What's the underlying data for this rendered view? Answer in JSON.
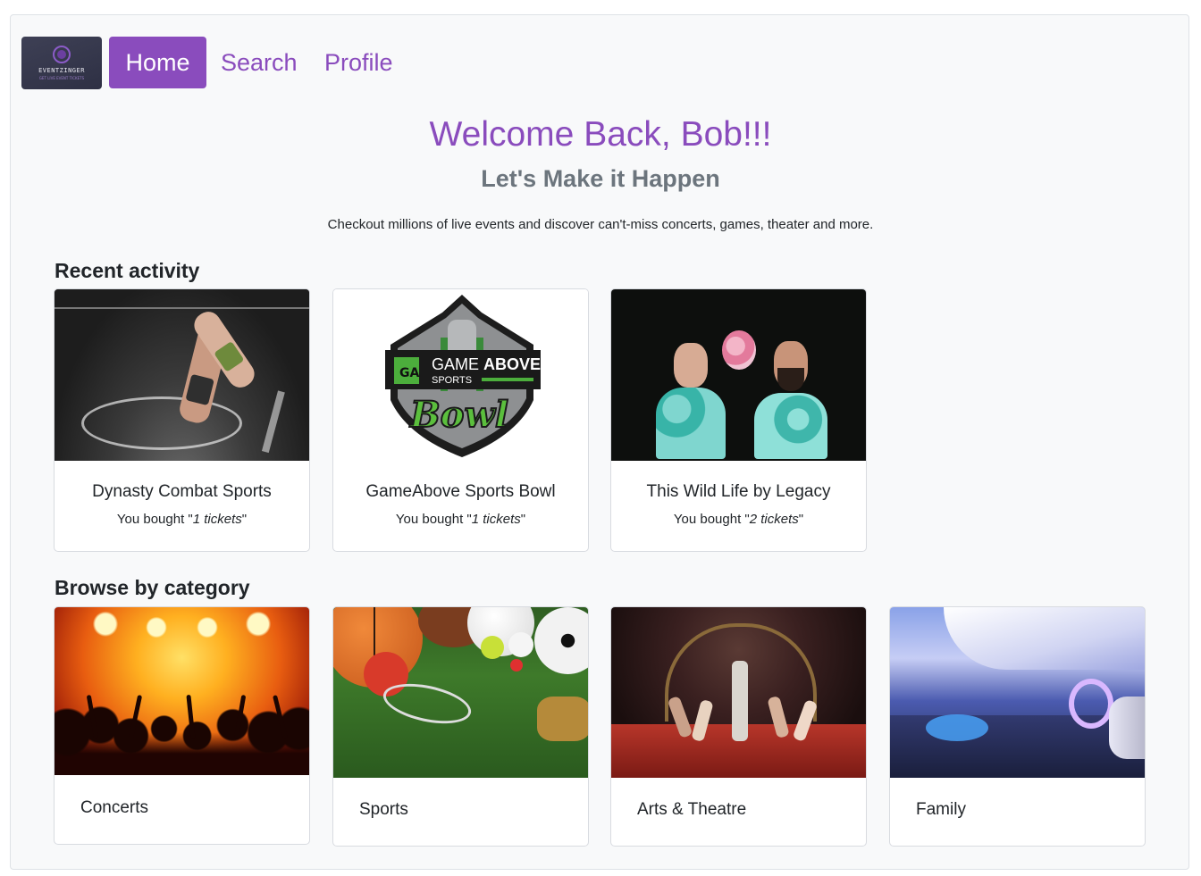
{
  "nav": {
    "logo_text": "EVENTZINGER",
    "logo_sub": "GET LIVE EVENT TICKETS",
    "items": [
      {
        "label": "Home",
        "active": true
      },
      {
        "label": "Search",
        "active": false
      },
      {
        "label": "Profile",
        "active": false
      }
    ]
  },
  "hero": {
    "welcome": "Welcome Back, Bob!!!",
    "tagline": "Let's Make it Happen",
    "lead": "Checkout millions of live events and discover can't-miss concerts, games, theater and more."
  },
  "recent": {
    "title": "Recent activity",
    "bought_prefix": "You bought \"",
    "bought_suffix": "\"",
    "items": [
      {
        "name": "Dynasty Combat Sports",
        "tickets": "1 tickets",
        "image": "mma-fight-photo"
      },
      {
        "name": "GameAbove Sports Bowl",
        "tickets": "1 tickets",
        "image": "gameabove-bowl-logo"
      },
      {
        "name": "This Wild Life by Legacy",
        "tickets": "2 tickets",
        "image": "band-photo"
      }
    ],
    "logo_words": {
      "game": "GAME",
      "above": "ABOVE",
      "sports": "SPORTS",
      "bowl": "Bowl",
      "initials": "GA"
    }
  },
  "browse": {
    "title": "Browse by category",
    "items": [
      {
        "name": "Concerts",
        "image": "concert-crowd-photo"
      },
      {
        "name": "Sports",
        "image": "sports-balls-photo"
      },
      {
        "name": "Arts & Theatre",
        "image": "theatre-stage-photo"
      },
      {
        "name": "Family",
        "image": "family-venue-photo"
      }
    ]
  },
  "colors": {
    "accent": "#8a4cbd",
    "muted": "#6c757d",
    "page_bg": "#f8f9fa",
    "logo_bg": "#3e4055"
  }
}
